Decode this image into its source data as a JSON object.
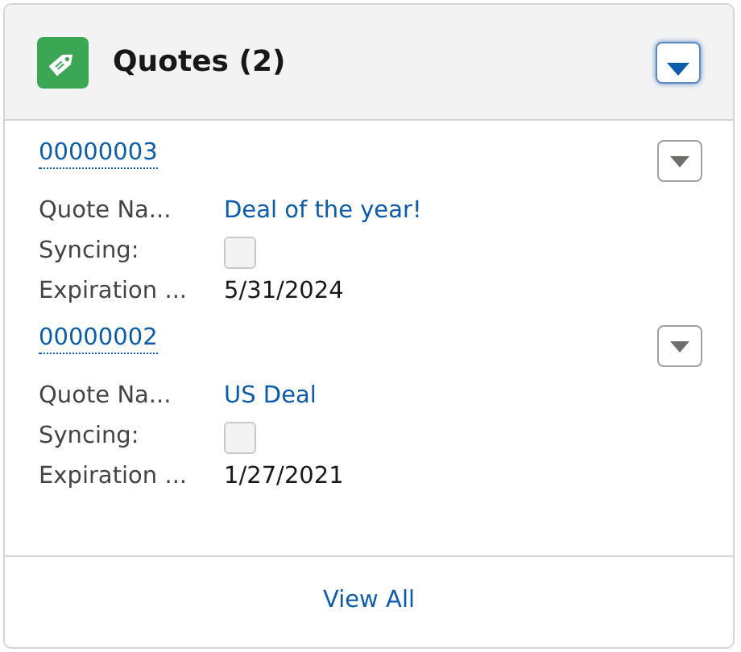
{
  "card": {
    "title": "Quotes (2)"
  },
  "records": [
    {
      "number": "00000003",
      "fields": [
        {
          "kind": "link",
          "label": "Quote Na...",
          "value": "Deal of the year!"
        },
        {
          "kind": "checkbox",
          "label": "Syncing:",
          "checked": false
        },
        {
          "kind": "text",
          "label": "Expiration ...",
          "value": "5/31/2024"
        }
      ]
    },
    {
      "number": "00000002",
      "fields": [
        {
          "kind": "link",
          "label": "Quote Na...",
          "value": "US Deal"
        },
        {
          "kind": "checkbox",
          "label": "Syncing:",
          "checked": false
        },
        {
          "kind": "text",
          "label": "Expiration ...",
          "value": "1/27/2021"
        }
      ]
    }
  ],
  "footer": {
    "link": "View All"
  }
}
